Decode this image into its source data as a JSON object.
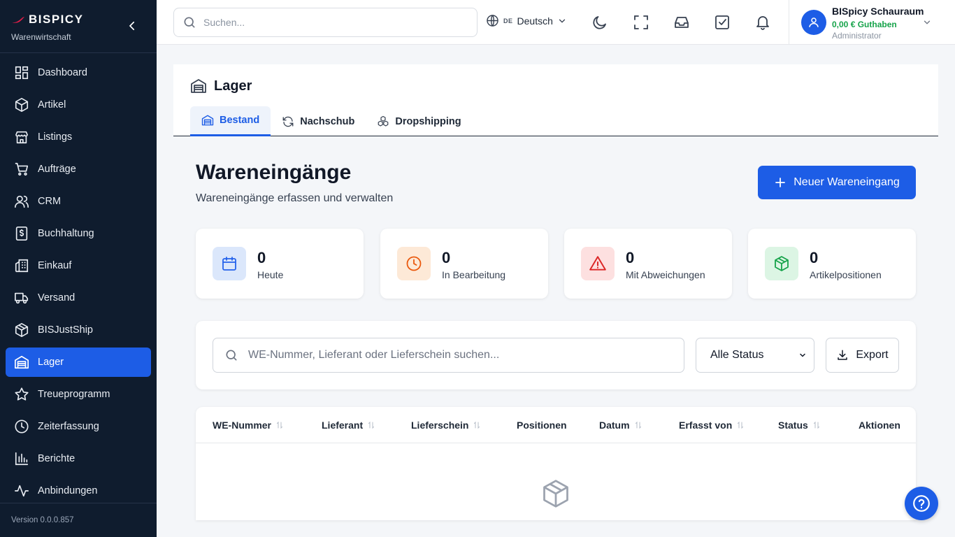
{
  "brand": {
    "name": "BISPICY",
    "subtitle": "Warenwirtschaft"
  },
  "sidebar": {
    "items": [
      {
        "label": "Dashboard",
        "icon": "dashboard-icon"
      },
      {
        "label": "Artikel",
        "icon": "box-icon"
      },
      {
        "label": "Listings",
        "icon": "store-icon"
      },
      {
        "label": "Aufträge",
        "icon": "cart-icon"
      },
      {
        "label": "CRM",
        "icon": "users-icon"
      },
      {
        "label": "Buchhaltung",
        "icon": "receipt-icon"
      },
      {
        "label": "Einkauf",
        "icon": "building-icon"
      },
      {
        "label": "Versand",
        "icon": "truck-icon"
      },
      {
        "label": "BISJustShip",
        "icon": "package-icon"
      },
      {
        "label": "Lager",
        "icon": "warehouse-icon",
        "active": true
      },
      {
        "label": "Treueprogramm",
        "icon": "star-icon"
      },
      {
        "label": "Zeiterfassung",
        "icon": "clock-icon"
      },
      {
        "label": "Berichte",
        "icon": "chart-icon"
      },
      {
        "label": "Anbindungen",
        "icon": "activity-icon"
      }
    ],
    "version": "Version 0.0.0.857"
  },
  "topbar": {
    "search_placeholder": "Suchen...",
    "language_code": "DE",
    "language_label": "Deutsch",
    "user_name": "BISpicy Schauraum",
    "user_balance": "0,00 € Guthaben",
    "user_role": "Administrator"
  },
  "page": {
    "title": "Lager",
    "tabs": [
      {
        "label": "Bestand",
        "active": true
      },
      {
        "label": "Nachschub"
      },
      {
        "label": "Dropshipping"
      }
    ]
  },
  "main": {
    "heading": "Wareneingänge",
    "subheading": "Wareneingänge erfassen und verwalten",
    "new_button": "Neuer Wareneingang"
  },
  "stats": [
    {
      "value": "0",
      "label": "Heute",
      "icon": "calendar-icon",
      "color": "#2563eb",
      "bg": "#dbe7fb"
    },
    {
      "value": "0",
      "label": "In Bearbeitung",
      "icon": "clock-icon",
      "color": "#ea580c",
      "bg": "#fde9d7"
    },
    {
      "value": "0",
      "label": "Mit Abweichungen",
      "icon": "warning-icon",
      "color": "#dc2626",
      "bg": "#fde0e0"
    },
    {
      "value": "0",
      "label": "Artikelpositionen",
      "icon": "package-icon",
      "color": "#16a34a",
      "bg": "#dcf5e4"
    }
  ],
  "filter": {
    "search_placeholder": "WE-Nummer, Lieferant oder Lieferschein suchen...",
    "status_selected": "Alle Status",
    "export_label": "Export"
  },
  "table": {
    "columns": [
      {
        "label": "WE-Nummer",
        "sortable": true
      },
      {
        "label": "Lieferant",
        "sortable": true
      },
      {
        "label": "Lieferschein",
        "sortable": true
      },
      {
        "label": "Positionen",
        "sortable": false
      },
      {
        "label": "Datum",
        "sortable": true
      },
      {
        "label": "Erfasst von",
        "sortable": true
      },
      {
        "label": "Status",
        "sortable": true
      },
      {
        "label": "Aktionen",
        "sortable": false
      }
    ],
    "rows": []
  },
  "colors": {
    "sidebar_bg": "#0f1c2e",
    "accent": "#1d5de6",
    "balance_green": "#16a34a"
  }
}
